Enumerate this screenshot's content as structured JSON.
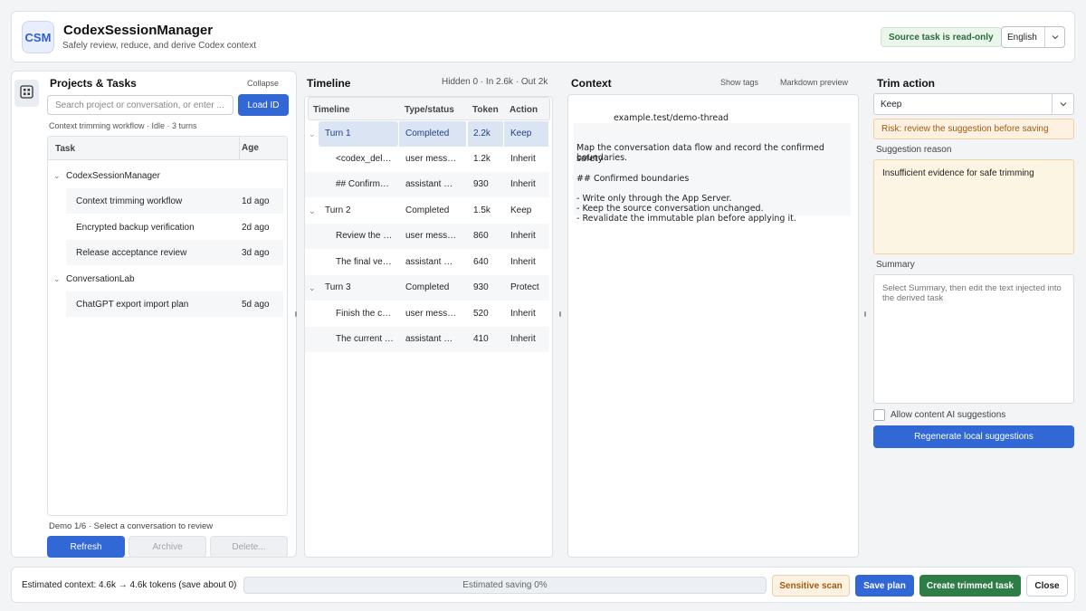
{
  "header": {
    "logo": "CSM",
    "title": "CodexSessionManager",
    "subtitle": "Safely review, reduce, and derive Codex context",
    "readonly_badge": "Source task is read-only",
    "language": "English"
  },
  "projects": {
    "title": "Projects & Tasks",
    "collapse": "Collapse",
    "search_placeholder": "Search project or conversation, or enter ...",
    "load_button": "Load ID",
    "status": "Context trimming workflow · Idle · 3 turns",
    "columns": {
      "task": "Task",
      "age": "Age"
    },
    "groups": [
      {
        "name": "CodexSessionManager",
        "tasks": [
          {
            "name": "Context trimming workflow",
            "age": "1d ago"
          },
          {
            "name": "Encrypted backup verification",
            "age": "2d ago"
          },
          {
            "name": "Release acceptance review",
            "age": "3d ago"
          }
        ]
      },
      {
        "name": "ConversationLab",
        "tasks": [
          {
            "name": "ChatGPT export import plan",
            "age": "5d ago"
          }
        ]
      }
    ],
    "footer_status": "Demo 1/6 · Select a conversation to review",
    "refresh": "Refresh",
    "archive": "Archive",
    "delete": "Delete..."
  },
  "timeline": {
    "title": "Timeline",
    "stats": "Hidden 0 · In 2.6k · Out 2k",
    "columns": {
      "timeline": "Timeline",
      "type": "Type/status",
      "token": "Token",
      "action": "Action"
    },
    "rows": [
      {
        "kind": "turn",
        "name": "Turn 1",
        "type": "Completed",
        "token": "2.2k",
        "action": "Keep",
        "selected": true
      },
      {
        "kind": "msg",
        "name": "<codex_delegation>",
        "type": "user message",
        "token": "1.2k",
        "action": "Inherit"
      },
      {
        "kind": "msg",
        "name": "## Confirmed boundaries",
        "type": "assistant message",
        "token": "930",
        "action": "Inherit"
      },
      {
        "kind": "turn",
        "name": "Turn 2",
        "type": "Completed",
        "token": "1.5k",
        "action": "Keep"
      },
      {
        "kind": "msg",
        "name": "Review the plan",
        "type": "user message",
        "token": "860",
        "action": "Inherit"
      },
      {
        "kind": "msg",
        "name": "The final version",
        "type": "assistant message",
        "token": "640",
        "action": "Inherit"
      },
      {
        "kind": "turn",
        "name": "Turn 3",
        "type": "Completed",
        "token": "930",
        "action": "Protect"
      },
      {
        "kind": "msg",
        "name": "Finish the check",
        "type": "user message",
        "token": "520",
        "action": "Inherit"
      },
      {
        "kind": "msg",
        "name": "The current state",
        "type": "assistant message",
        "token": "410",
        "action": "Inherit"
      }
    ]
  },
  "context": {
    "title": "Context",
    "show_tags": "Show tags",
    "markdown_preview": "Markdown preview",
    "url": "example.test/demo-thread",
    "lines": [
      "Map the conversation data flow and record the confirmed safety",
      "boundaries.",
      "",
      "## Confirmed boundaries",
      "",
      "- Write only through the App Server.",
      "- Keep the source conversation unchanged.",
      "- Revalidate the immutable plan before applying it."
    ]
  },
  "trim": {
    "title": "Trim action",
    "action_value": "Keep",
    "risk": "Risk: review the suggestion before saving",
    "reason_label": "Suggestion reason",
    "reason_text": "Insufficient evidence for safe trimming",
    "summary_label": "Summary",
    "summary_placeholder": "Select Summary, then edit the text injected into the derived task",
    "allow_ai_label": "Allow content AI suggestions",
    "allow_ai_checked": false,
    "regenerate": "Regenerate local suggestions"
  },
  "footer": {
    "estimate": "Estimated context: 4.6k → 4.6k tokens (save about 0)",
    "saving_text": "Estimated saving 0%",
    "saving_percent": 0,
    "sensitive_scan": "Sensitive scan",
    "save_plan": "Save plan",
    "create_task": "Create trimmed task",
    "close": "Close"
  },
  "colors": {
    "primary": "#3267d6",
    "success": "#2e7d46",
    "warning_bg": "#fdf1e2",
    "reason_bg": "#fdf5e4"
  }
}
